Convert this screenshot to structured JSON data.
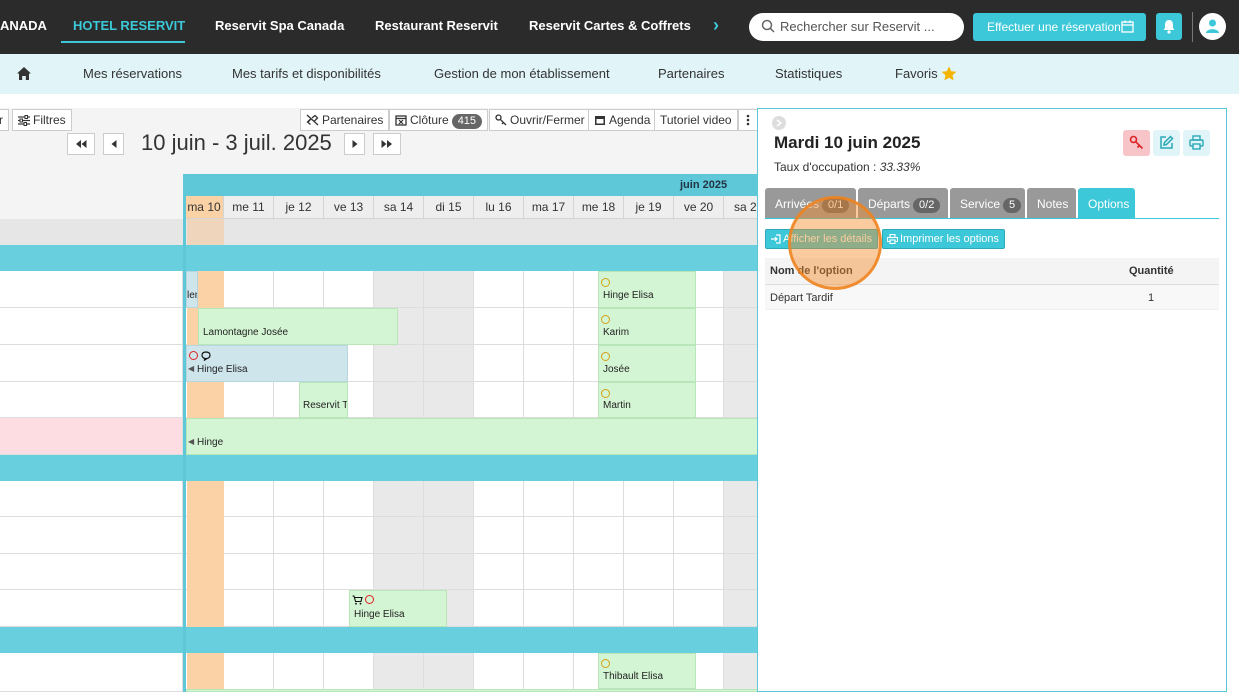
{
  "topnav": {
    "items": [
      "ANADA",
      "HOTEL RESERVIT",
      "Reservit Spa Canada",
      "Restaurant Reservit",
      "Reservit Cartes & Coffrets"
    ],
    "search_placeholder": "Rechercher sur Reservit ...",
    "reserve_label": "Effectuer une réservation"
  },
  "subnav": {
    "items": [
      "Mes réservations",
      "Mes tarifs et disponibilités",
      "Gestion de mon établissement",
      "Partenaires",
      "Statistiques",
      "Favoris"
    ]
  },
  "toolbar": {
    "cut_label": "r",
    "filters_label": "Filtres",
    "partners_label": "Partenaires",
    "closure_label": "Clôture",
    "closure_count": "415",
    "open_close_label": "Ouvrir/Fermer",
    "agenda_label": "Agenda",
    "tutorial_label": "Tutoriel video"
  },
  "calendar": {
    "range": "10 juin - 3 juil. 2025",
    "month": "juin 2025",
    "days": [
      "ma 10",
      "me 11",
      "je 12",
      "ve 13",
      "sa 14",
      "di 15",
      "lu 16",
      "ma 17",
      "me 18",
      "je 19",
      "ve 20",
      "sa 2"
    ]
  },
  "bookings": {
    "r1_cut": "len",
    "r1_b": "Hinge Elisa",
    "r2_a": "Lamontagne Josée",
    "r2_b": "Karim",
    "r3_a": "Hinge Elisa",
    "r3_b": "Josée",
    "r4_a": "Reservit Te",
    "r4_b": "Martin",
    "r5_a": "Hinge",
    "r9_a": "Hinge Elisa",
    "r10_a": "Thibault Elisa"
  },
  "panel": {
    "title": "Mardi 10 juin 2025",
    "rate_label": "Taux d'occupation : ",
    "rate_value": "33.33%",
    "tabs": [
      {
        "label": "Arrivées",
        "count": "0/1"
      },
      {
        "label": "Départs",
        "count": "0/2"
      },
      {
        "label": "Service",
        "count": "5"
      },
      {
        "label": "Notes",
        "count": ""
      },
      {
        "label": "Options",
        "count": ""
      }
    ],
    "details_btn": "Afficher les détails",
    "print_btn": "Imprimer les options",
    "col_name": "Nom de l'option",
    "col_qty": "Quantité",
    "row_name": "Départ Tardif",
    "row_qty": "1"
  },
  "colors": {
    "accent": "#3cc8d8",
    "topbar": "#2b2b2b",
    "subbar": "#e1f4f8",
    "today": "#fbd2a6",
    "booking_green": "#d4f5d4",
    "highlight": "#f58c28"
  }
}
